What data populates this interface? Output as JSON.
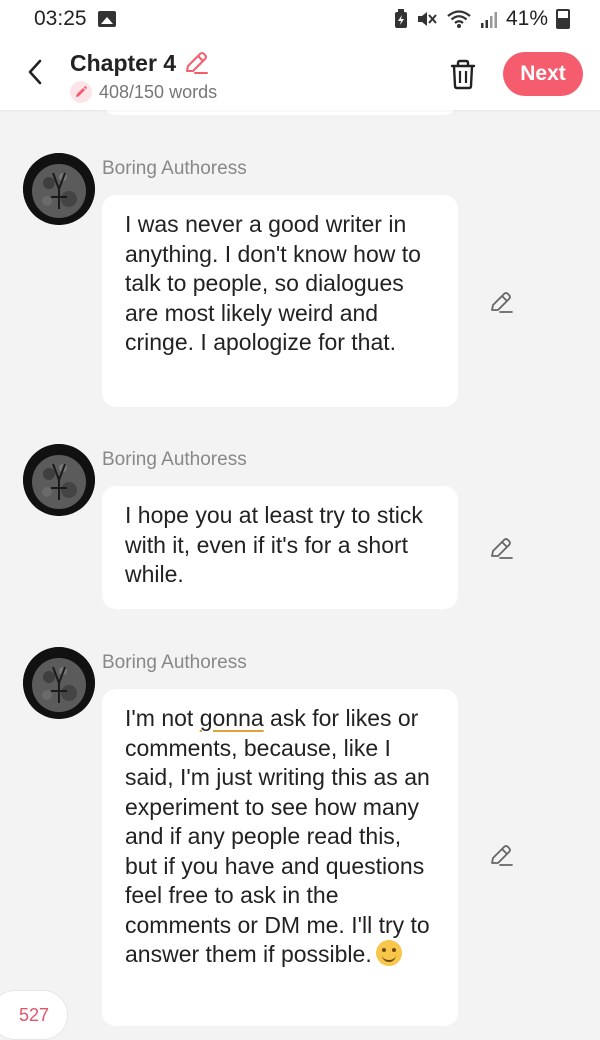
{
  "status": {
    "time": "03:25",
    "battery": "41%"
  },
  "header": {
    "title": "Chapter 4",
    "word_count": "408/150 words",
    "next_label": "Next"
  },
  "messages": [
    {
      "author": "Boring Authoress",
      "text": "I was never a good writer in anything. I don't know how to talk to people, so dialogues are most likely weird and cringe. I apologize for that."
    },
    {
      "author": "Boring Authoress",
      "text": "I hope you at least try to stick with it, even if it's for a short while."
    },
    {
      "author": "Boring Authoress",
      "text_before": "I'm not ",
      "text_underlined": "gonna",
      "text_after": " ask for likes or comments, because, like I said, I'm just writing this as an experiment to see how many and if any people read this, but if you have and questions feel free to ask in the comments or DM me. I'll try to answer them if possible."
    }
  ],
  "footer": {
    "count": "527"
  },
  "colors": {
    "accent": "#f55d6f",
    "background": "#f3f3f3",
    "bubble": "#ffffff"
  },
  "icons": [
    "image-icon",
    "battery-saver-icon",
    "mute-icon",
    "wifi-icon",
    "signal-icon",
    "battery-icon",
    "back-icon",
    "pencil-icon",
    "trash-icon",
    "avatar-moon-icon",
    "smile-emoji-icon"
  ]
}
